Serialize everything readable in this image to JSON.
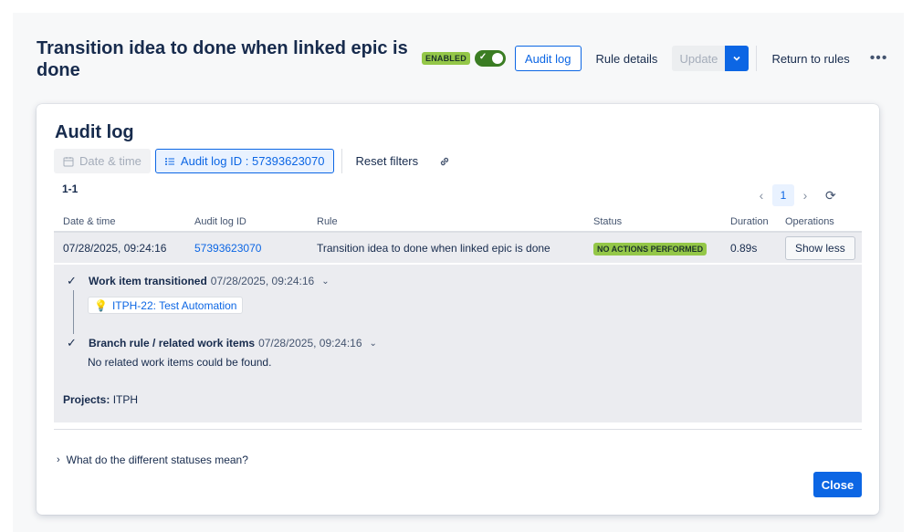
{
  "header": {
    "title": "Transition idea to done when linked epic is done",
    "enabled_label": "ENABLED",
    "toggle_on": true,
    "audit_log_label": "Audit log",
    "rule_details_label": "Rule details",
    "update_label": "Update",
    "return_label": "Return to rules",
    "more_icon": "more-horizontal-icon"
  },
  "audit": {
    "title": "Audit log",
    "filters": {
      "date_label": "Date & time",
      "audit_id_label": "Audit log ID : 57393623070",
      "reset_label": "Reset filters"
    },
    "range": "1-1",
    "pagination": {
      "current": "1"
    },
    "columns": [
      "Date & time",
      "Audit log ID",
      "Rule",
      "Status",
      "Duration",
      "Operations"
    ],
    "row": {
      "date": "07/28/2025, 09:24:16",
      "id": "57393623070",
      "rule": "Transition idea to done when linked epic is done",
      "status": "NO ACTIONS PERFORMED",
      "duration": "0.89s",
      "operation": "Show less"
    },
    "details": {
      "step1_label": "Work item transitioned",
      "step1_time": "07/28/2025, 09:24:16",
      "issue": "ITPH-22: Test Automation",
      "step2_label": "Branch rule / related work items",
      "step2_time": "07/28/2025, 09:24:16",
      "no_related": "No related work items could be found.",
      "projects_label": "Projects:",
      "projects_value": "ITPH"
    },
    "faq": "What do the different statuses mean?",
    "close_label": "Close"
  },
  "colors": {
    "accent": "#0c66e4",
    "success_badge": "#94c748",
    "toggle": "#3b7d23"
  }
}
